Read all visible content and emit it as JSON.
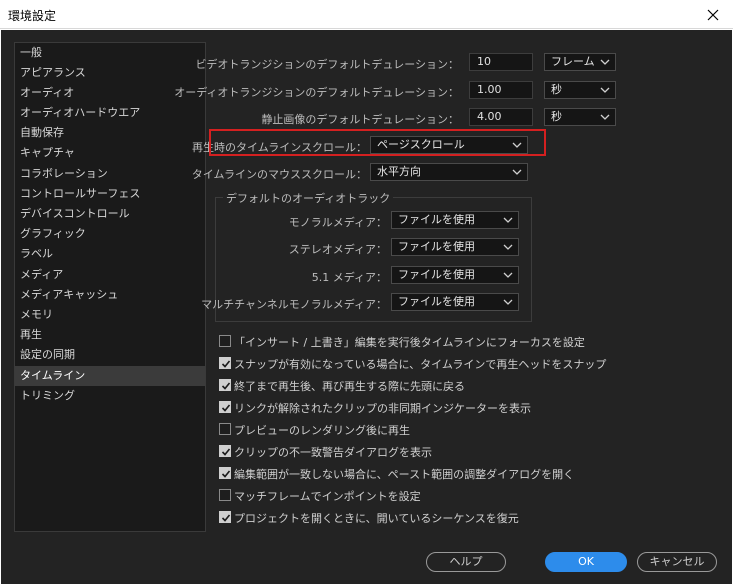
{
  "window": {
    "title": "環境設定"
  },
  "sidebar": {
    "items": [
      {
        "label": "一般"
      },
      {
        "label": "アピアランス"
      },
      {
        "label": "オーディオ"
      },
      {
        "label": "オーディオハードウエア"
      },
      {
        "label": "自動保存"
      },
      {
        "label": "キャプチャ"
      },
      {
        "label": "コラボレーション"
      },
      {
        "label": "コントロールサーフェス"
      },
      {
        "label": "デバイスコントロール"
      },
      {
        "label": "グラフィック"
      },
      {
        "label": "ラベル"
      },
      {
        "label": "メディア"
      },
      {
        "label": "メディアキャッシュ"
      },
      {
        "label": "メモリ"
      },
      {
        "label": "再生"
      },
      {
        "label": "設定の同期"
      },
      {
        "label": "タイムライン",
        "selected": true
      },
      {
        "label": "トリミング"
      }
    ]
  },
  "settings": {
    "video_transition": {
      "label": "ビデオトランジションのデフォルトデュレーション：",
      "value": "10",
      "unit": "フレーム"
    },
    "audio_transition": {
      "label": "オーディオトランジションのデフォルトデュレーション：",
      "value": "1.00",
      "unit": "秒"
    },
    "still_image": {
      "label": "静止画像のデフォルトデュレーション：",
      "value": "4.00",
      "unit": "秒"
    },
    "playback_scroll": {
      "label": "再生時のタイムラインスクロール：",
      "value": "ページスクロール"
    },
    "mouse_scroll": {
      "label": "タイムラインのマウススクロール：",
      "value": "水平方向"
    }
  },
  "audio_track": {
    "title": "デフォルトのオーディオトラック",
    "rows": [
      {
        "label": "モノラルメディア：",
        "value": "ファイルを使用"
      },
      {
        "label": "ステレオメディア：",
        "value": "ファイルを使用"
      },
      {
        "label": "5.1 メディア：",
        "value": "ファイルを使用"
      },
      {
        "label": "マルチチャンネルモノラルメディア：",
        "value": "ファイルを使用"
      }
    ]
  },
  "checkboxes": [
    {
      "label": "「インサート / 上書き」編集を実行後タイムラインにフォーカスを設定",
      "checked": false
    },
    {
      "label": "スナップが有効になっている場合に、タイムラインで再生ヘッドをスナップ",
      "checked": true
    },
    {
      "label": "終了まで再生後、再び再生する際に先頭に戻る",
      "checked": true
    },
    {
      "label": "リンクが解除されたクリップの非同期インジケーターを表示",
      "checked": true
    },
    {
      "label": "プレビューのレンダリング後に再生",
      "checked": false
    },
    {
      "label": "クリップの不一致警告ダイアログを表示",
      "checked": true
    },
    {
      "label": "編集範囲が一致しない場合に、ペースト範囲の調整ダイアログを開く",
      "checked": true
    },
    {
      "label": "マッチフレームでインポイントを設定",
      "checked": false
    },
    {
      "label": "プロジェクトを開くときに、開いているシーケンスを復元",
      "checked": true
    }
  ],
  "buttons": {
    "help": "ヘルプ",
    "ok": "OK",
    "cancel": "キャンセル"
  },
  "colors": {
    "accent": "#2d8ceb",
    "highlight": "#d42020",
    "background": "#232323"
  },
  "icons": {
    "close": "close-icon",
    "dropdown": "chevron-down-icon",
    "check": "checkmark-icon"
  }
}
